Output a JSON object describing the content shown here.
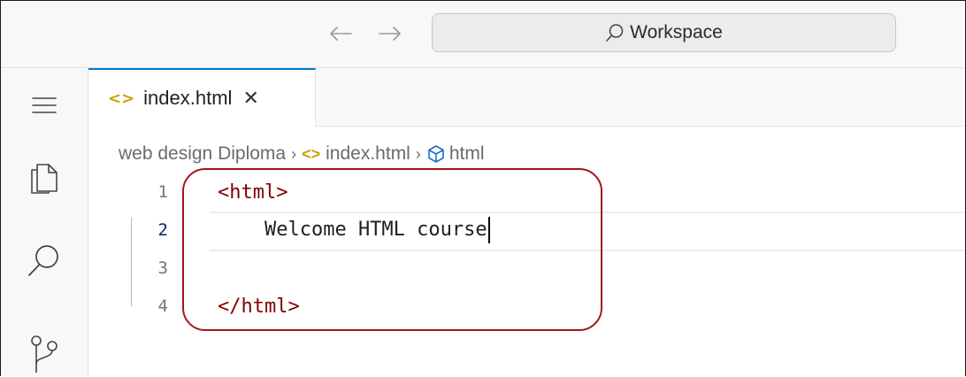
{
  "titlebar": {
    "back_icon": "arrow-left-icon",
    "forward_icon": "arrow-right-icon",
    "search": {
      "icon": "search-icon",
      "label": "Workspace"
    }
  },
  "activitybar": {
    "items": [
      {
        "icon": "menu-icon"
      },
      {
        "icon": "explorer-icon"
      },
      {
        "icon": "search-icon"
      },
      {
        "icon": "source-control-icon"
      }
    ]
  },
  "tabs": [
    {
      "label": "index.html",
      "icon": "html-file-icon",
      "close_glyph": "✕",
      "active": true
    }
  ],
  "breadcrumb": {
    "items": [
      "web design Diploma",
      "index.html",
      "html"
    ],
    "separator": "›"
  },
  "editor": {
    "current_line": 2,
    "lines": [
      {
        "number": "1",
        "text": "<html>"
      },
      {
        "number": "2",
        "text": "    Welcome HTML course"
      },
      {
        "number": "3",
        "text": ""
      },
      {
        "number": "4",
        "text": "</html>"
      }
    ]
  },
  "colors": {
    "accent": "#0078d4",
    "tag": "#800000",
    "html_icon": "#c9a100",
    "annotation": "#a4161a"
  }
}
